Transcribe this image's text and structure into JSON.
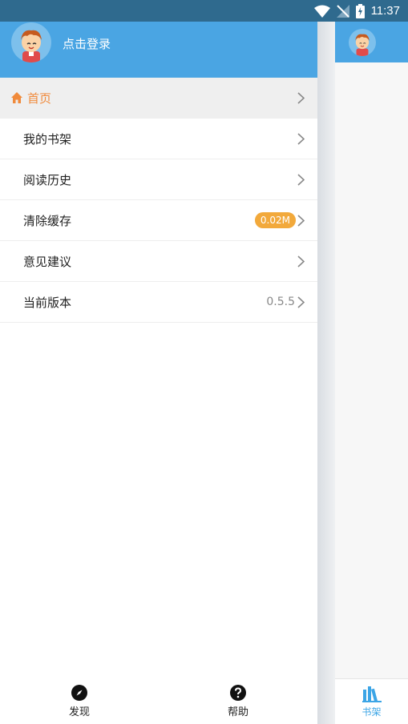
{
  "status_bar": {
    "time": "11:37",
    "icons": [
      "wifi-icon",
      "no-signal-icon",
      "battery-charging-icon"
    ]
  },
  "drawer": {
    "header": {
      "login_label": "点击登录",
      "avatar": "cartoon-boy-avatar"
    },
    "menu": [
      {
        "label": "首页",
        "icon": "home-icon",
        "selected": true
      },
      {
        "label": "我的书架"
      },
      {
        "label": "阅读历史"
      },
      {
        "label": "清除缓存",
        "badge": "0.02M"
      },
      {
        "label": "意见建议"
      },
      {
        "label": "当前版本",
        "value": "0.5.5"
      }
    ],
    "bottom": [
      {
        "label": "发现",
        "icon": "compass-icon"
      },
      {
        "label": "帮助",
        "icon": "help-icon"
      }
    ]
  },
  "background_app": {
    "bottom_tab": {
      "label": "书架",
      "icon": "bookshelf-icon"
    }
  },
  "colors": {
    "header": "#4aa5e3",
    "status_bar": "#2f6a8e",
    "accent_orange": "#f08a3b",
    "badge": "#f2a93b",
    "tab_blue": "#3ca5e6"
  }
}
